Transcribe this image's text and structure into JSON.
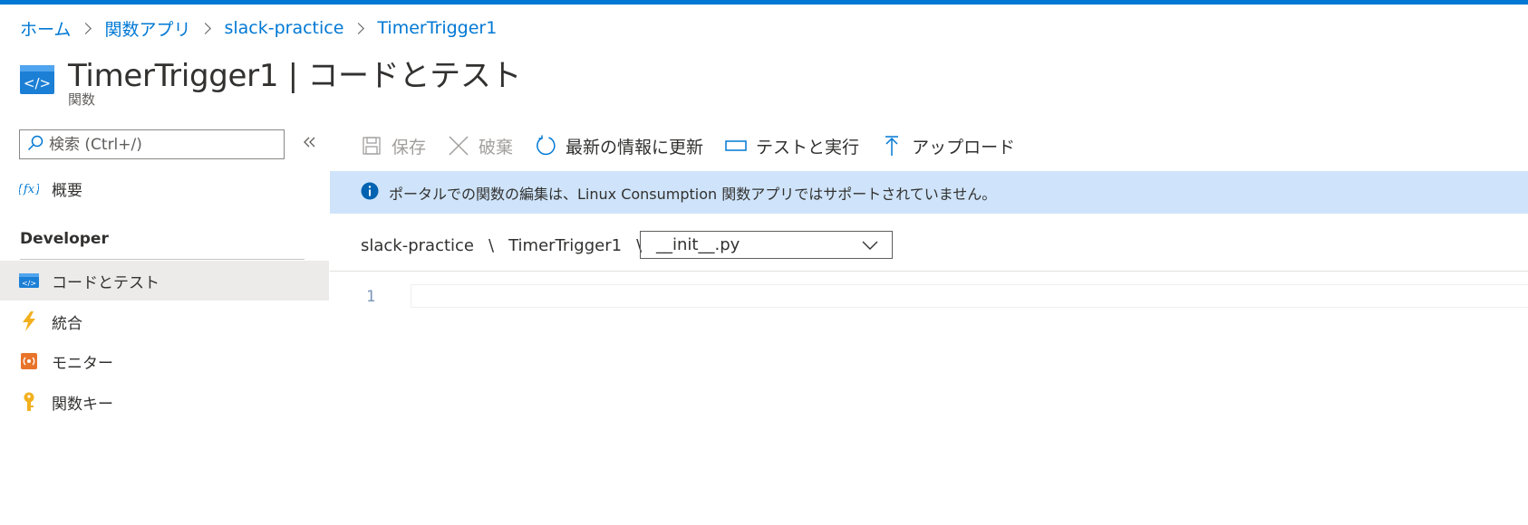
{
  "breadcrumb": {
    "home": "ホーム",
    "function_app": "関数アプリ",
    "app_name": "slack-practice",
    "function_name": "TimerTrigger1"
  },
  "header": {
    "title": "TimerTrigger1 | コードとテスト",
    "subtitle": "関数",
    "icon": "code-function-icon"
  },
  "sidebar": {
    "search_placeholder": "検索 (Ctrl+/)",
    "overview": {
      "label": "概要",
      "icon": "function-fx-icon"
    },
    "section_label": "Developer",
    "items": [
      {
        "label": "コードとテスト",
        "icon": "code-icon",
        "selected": true
      },
      {
        "label": "統合",
        "icon": "lightning-icon",
        "selected": false
      },
      {
        "label": "モニター",
        "icon": "monitor-icon",
        "selected": false
      },
      {
        "label": "関数キー",
        "icon": "key-icon",
        "selected": false
      }
    ]
  },
  "toolbar": {
    "save": "保存",
    "discard": "破棄",
    "refresh": "最新の情報に更新",
    "test_run": "テストと実行",
    "upload": "アップロード"
  },
  "banner": {
    "message": "ポータルでの関数の編集は、Linux Consumption 関数アプリではサポートされていません。",
    "icon": "info-icon"
  },
  "file_path": {
    "app": "slack-practice",
    "separator": "\\",
    "function": "TimerTrigger1",
    "selected_file": "__init__.py"
  },
  "editor": {
    "line_number": "1"
  },
  "colors": {
    "accent": "#0078d4",
    "banner_bg": "#cfe4fa",
    "selected_bg": "#edebe9"
  }
}
